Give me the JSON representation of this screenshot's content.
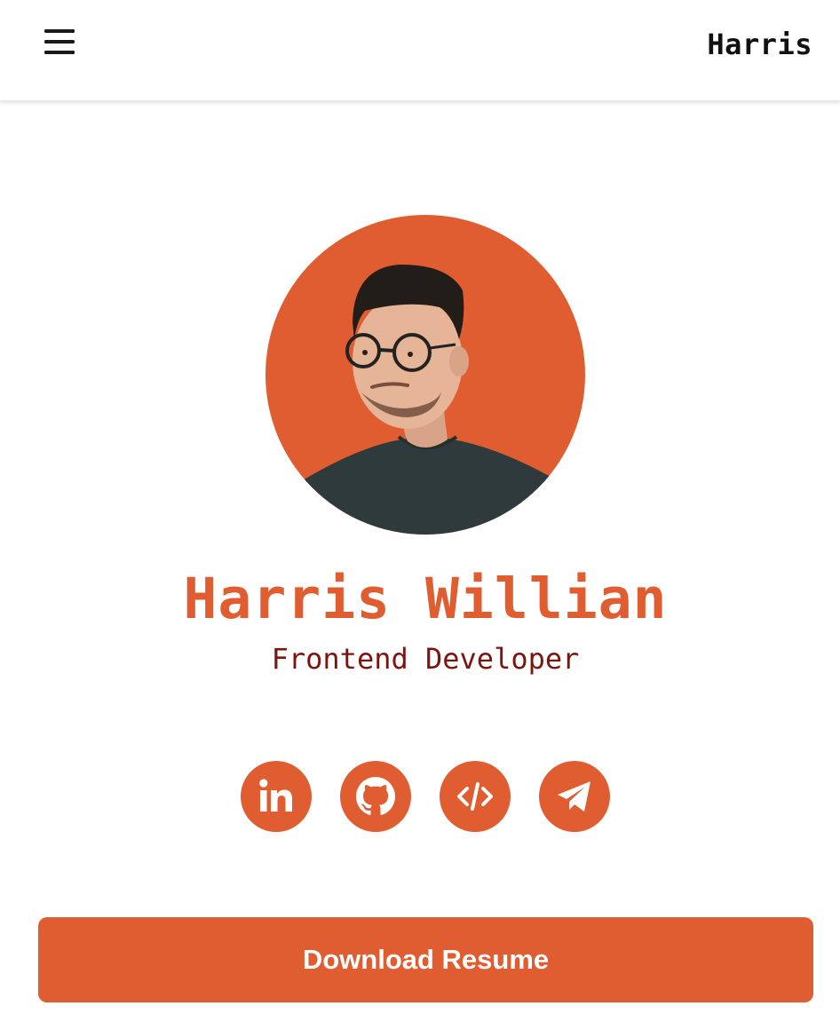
{
  "header": {
    "brand": "Harris",
    "menu_icon": "hamburger-menu-icon"
  },
  "profile": {
    "name": "Harris Willian",
    "role": "Frontend Developer",
    "avatar_bg": "#e05d31"
  },
  "socials": [
    {
      "icon": "linkedin-icon"
    },
    {
      "icon": "github-icon"
    },
    {
      "icon": "code-icon"
    },
    {
      "icon": "telegram-icon"
    }
  ],
  "cta": {
    "label": "Download Resume"
  },
  "colors": {
    "accent": "#e05d31",
    "role_text": "#7a1510",
    "brand_text": "#111111"
  }
}
